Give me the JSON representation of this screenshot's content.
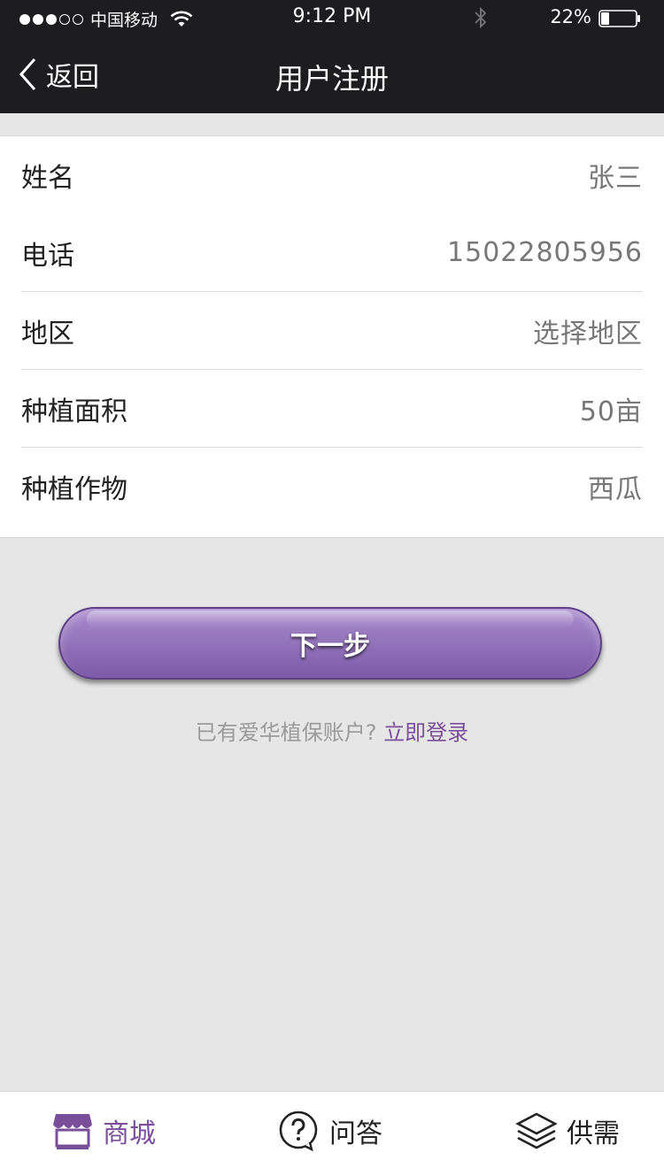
{
  "status_bar": {
    "carrier": "中国移动",
    "time": "9:12 PM",
    "battery": "22%",
    "signal_bars_filled": 3,
    "signal_bars_total": 5
  },
  "nav": {
    "back_label": "返回",
    "title": "用户注册"
  },
  "form": {
    "rows": [
      {
        "label": "姓名",
        "value": "张三"
      },
      {
        "label": "电话",
        "value": "15022805956"
      },
      {
        "label": "地区",
        "value": "选择地区"
      },
      {
        "label": "种植面积",
        "value": "50亩"
      },
      {
        "label": "种植作物",
        "value": "西瓜"
      }
    ]
  },
  "next_button": {
    "label": "下一步"
  },
  "login": {
    "prompt": "已有爱华植保账户?",
    "link": "立即登录"
  },
  "tabbar": {
    "tabs": [
      {
        "label": "商城",
        "icon": "store-icon",
        "active": true
      },
      {
        "label": "问答",
        "icon": "question-icon",
        "active": false
      },
      {
        "label": "供需",
        "icon": "layers-icon",
        "active": false
      }
    ]
  },
  "colors": {
    "accent": "#7a4f9a",
    "topbar": "#1d1d1f",
    "background": "#e6e6e6"
  }
}
